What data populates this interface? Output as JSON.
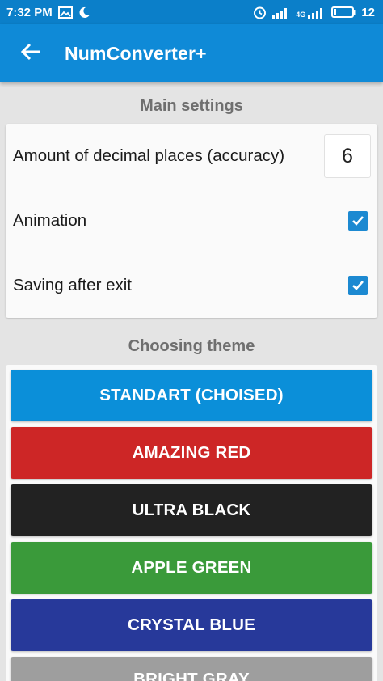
{
  "status_bar": {
    "time": "7:32 PM",
    "network_type": "4G",
    "battery_level": "12",
    "icons": [
      "image-icon",
      "moon-icon",
      "alarm-icon",
      "signal-icon",
      "signal-4g-icon",
      "battery-icon"
    ]
  },
  "app_bar": {
    "title": "NumConverter+",
    "back_icon": "arrow-left-icon"
  },
  "main_settings": {
    "header": "Main settings",
    "decimal_places": {
      "label": "Amount of decimal places (accuracy)",
      "value": "6"
    },
    "animation": {
      "label": "Animation",
      "checked": true
    },
    "saving_after_exit": {
      "label": "Saving after exit",
      "checked": true
    }
  },
  "themes": {
    "header": "Choosing theme",
    "items": [
      {
        "label": "STANDART (CHOISED)",
        "color": "#0b8fd9"
      },
      {
        "label": "AMAZING RED",
        "color": "#cd2626"
      },
      {
        "label": "ULTRA BLACK",
        "color": "#222222"
      },
      {
        "label": "APPLE GREEN",
        "color": "#3a9a3a"
      },
      {
        "label": "CRYSTAL BLUE",
        "color": "#27399a"
      },
      {
        "label": "BRIGHT GRAY",
        "color": "#9e9e9e"
      }
    ]
  },
  "colors": {
    "status_bar": "#0b7fc9",
    "app_bar": "#0f8ad7",
    "background": "#e4e4e4",
    "checkbox": "#1c89d1"
  }
}
